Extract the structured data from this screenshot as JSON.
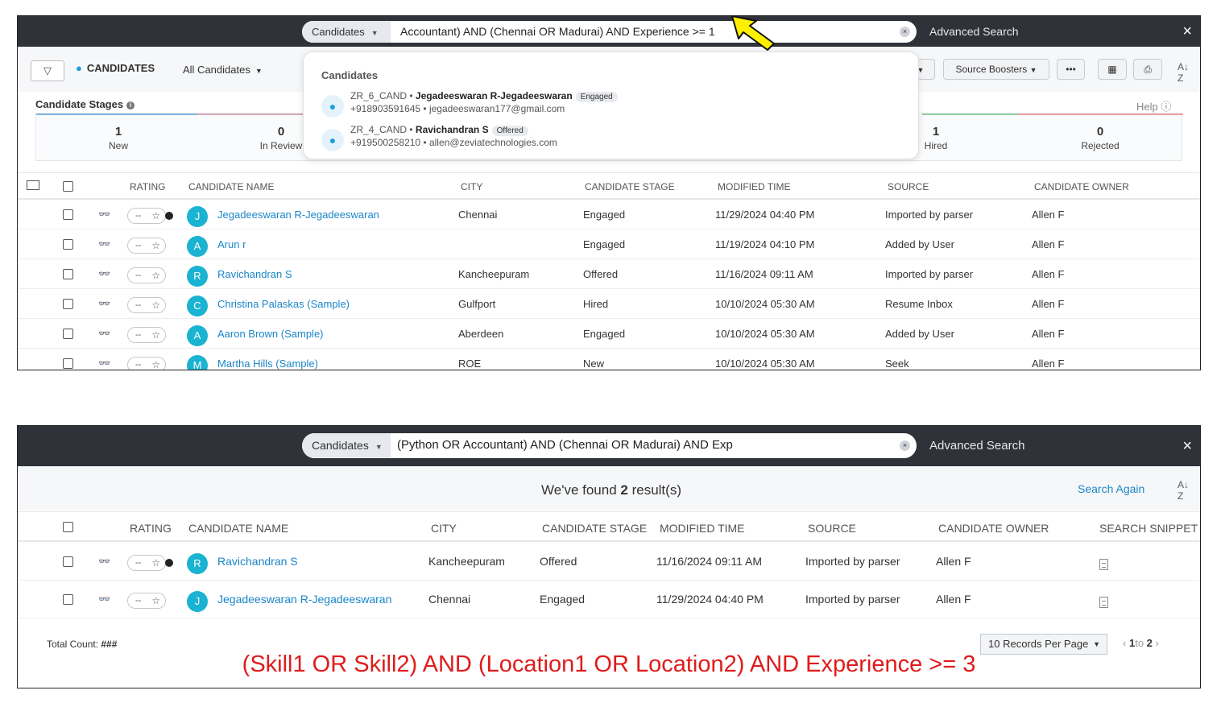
{
  "panel1": {
    "search": {
      "module": "Candidates",
      "query": "Accountant) AND (Chennai OR Madurai) AND Experience >= 1",
      "clear_glyph": "×",
      "advanced": "Advanced Search",
      "close_glyph": "×"
    },
    "toolbar": {
      "title": "CANDIDATES",
      "view": "All Candidates",
      "source_boosters": "Source Boosters",
      "more": "•••"
    },
    "stages": {
      "label": "Candidate Stages",
      "help": "Help",
      "items": [
        {
          "count": "1",
          "label": "New"
        },
        {
          "count": "0",
          "label": "In Review"
        },
        {
          "count": "1",
          "label": "Hired"
        },
        {
          "count": "0",
          "label": "Rejected"
        }
      ]
    },
    "dropdown": {
      "title": "Candidates",
      "items": [
        {
          "id": "ZR_6_CAND",
          "name": "Jegadeeswaran R-Jegadeeswaran",
          "stage": "Engaged",
          "phone": "+918903591645",
          "email": "jegadeeswaran177@gmail.com"
        },
        {
          "id": "ZR_4_CAND",
          "name": "Ravichandran S",
          "stage": "Offered",
          "phone": "+919500258210",
          "email": "allen@zeviatechnologies.com"
        }
      ]
    },
    "columns": [
      "RATING",
      "CANDIDATE NAME",
      "CITY",
      "CANDIDATE STAGE",
      "MODIFIED TIME",
      "SOURCE",
      "CANDIDATE OWNER"
    ],
    "rows": [
      {
        "initial": "J",
        "name": "Jegadeeswaran R-Jegadeeswaran",
        "city": "Chennai",
        "stage": "Engaged",
        "modified": "11/29/2024 04:40 PM",
        "source": "Imported by parser",
        "owner": "Allen F",
        "rating": "--"
      },
      {
        "initial": "A",
        "name": "Arun r",
        "city": "",
        "stage": "Engaged",
        "modified": "11/19/2024 04:10 PM",
        "source": "Added by User",
        "owner": "Allen F",
        "rating": "--"
      },
      {
        "initial": "R",
        "name": "Ravichandran S",
        "city": "Kancheepuram",
        "stage": "Offered",
        "modified": "11/16/2024 09:11 AM",
        "source": "Imported by parser",
        "owner": "Allen F",
        "rating": "--"
      },
      {
        "initial": "C",
        "name": "Christina Palaskas (Sample)",
        "city": "Gulfport",
        "stage": "Hired",
        "modified": "10/10/2024 05:30 AM",
        "source": "Resume Inbox",
        "owner": "Allen F",
        "rating": "--"
      },
      {
        "initial": "A",
        "name": "Aaron Brown (Sample)",
        "city": "Aberdeen",
        "stage": "Engaged",
        "modified": "10/10/2024 05:30 AM",
        "source": "Added by User",
        "owner": "Allen F",
        "rating": "--"
      },
      {
        "initial": "M",
        "name": "Martha Hills (Sample)",
        "city": "ROE",
        "stage": "New",
        "modified": "10/10/2024 05:30 AM",
        "source": "Seek",
        "owner": "Allen F",
        "rating": "--"
      }
    ]
  },
  "panel2": {
    "search": {
      "module": "Candidates",
      "query": "(Python OR Accountant) AND (Chennai OR Madurai) AND Exp",
      "clear_glyph": "×",
      "advanced": "Advanced Search",
      "close_glyph": "×"
    },
    "found": {
      "prefix": "We've found ",
      "count": "2",
      "suffix": " result(s)"
    },
    "search_again": "Search Again",
    "columns": [
      "RATING",
      "CANDIDATE NAME",
      "CITY",
      "CANDIDATE STAGE",
      "MODIFIED TIME",
      "SOURCE",
      "CANDIDATE OWNER",
      "SEARCH SNIPPET"
    ],
    "rows": [
      {
        "initial": "R",
        "name": "Ravichandran S",
        "city": "Kancheepuram",
        "stage": "Offered",
        "modified": "11/16/2024 09:11 AM",
        "source": "Imported by parser",
        "owner": "Allen F",
        "rating": "--"
      },
      {
        "initial": "J",
        "name": "Jegadeeswaran R-Jegadeeswaran",
        "city": "Chennai",
        "stage": "Engaged",
        "modified": "11/29/2024 04:40 PM",
        "source": "Imported by parser",
        "owner": "Allen F",
        "rating": "--"
      }
    ],
    "total_count_label": "Total Count: ",
    "total_count_value": "###",
    "per_page": "10 Records Per Page",
    "pager": {
      "from": "1",
      "to_word": "to",
      "to": "2"
    }
  },
  "annotation": "(Skill1 OR Skill2) AND (Location1 OR Location2) AND Experience >= 3",
  "colors": {
    "topbar": "#2f3238",
    "link": "#1a86c8",
    "avatar": "#1ab3d1",
    "annotation": "#e01b1b",
    "arrow": "#ffef00"
  }
}
